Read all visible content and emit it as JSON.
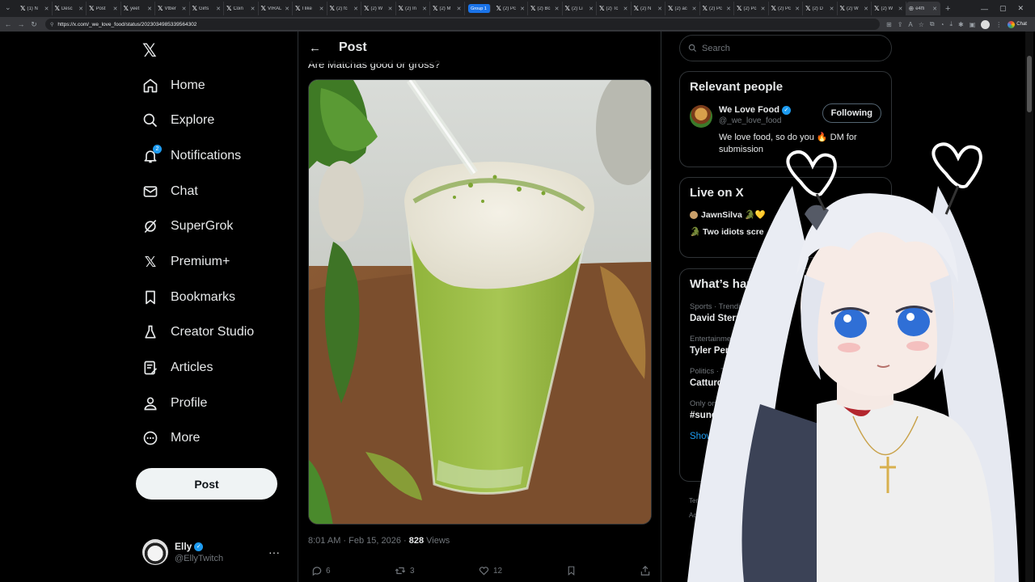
{
  "browser": {
    "tabs": [
      {
        "label": "(1) N"
      },
      {
        "label": "Desc"
      },
      {
        "label": "Post"
      },
      {
        "label": "yeet"
      },
      {
        "label": "Vtber"
      },
      {
        "label": "Girls"
      },
      {
        "label": "Coin"
      },
      {
        "label": "VIRAL"
      },
      {
        "label": "I like"
      },
      {
        "label": "(2) fc"
      },
      {
        "label": "(2) W"
      },
      {
        "label": "(2) In"
      },
      {
        "label": "(2) M"
      }
    ],
    "group_label": "Group 1",
    "tabs_after_group": [
      {
        "label": "(2) Pc"
      },
      {
        "label": "(2) Bc"
      },
      {
        "label": "(2) Li"
      },
      {
        "label": "(2) Tc"
      },
      {
        "label": "(2) N"
      },
      {
        "label": "(2) ac"
      },
      {
        "label": "(2) Pc"
      },
      {
        "label": "(2) Pc"
      },
      {
        "label": "(2) Pc"
      },
      {
        "label": "(2) D"
      },
      {
        "label": "(2) W"
      },
      {
        "label": "(2) W"
      }
    ],
    "last_tab": "e4ffi",
    "url": "https://x.com/_we_love_food/status/2023034985339564302",
    "chat_label": "Chat"
  },
  "nav": {
    "items": [
      {
        "label": "Home"
      },
      {
        "label": "Explore"
      },
      {
        "label": "Notifications",
        "badge": "2"
      },
      {
        "label": "Chat"
      },
      {
        "label": "SuperGrok"
      },
      {
        "label": "Premium+"
      },
      {
        "label": "Bookmarks"
      },
      {
        "label": "Creator Studio"
      },
      {
        "label": "Articles"
      },
      {
        "label": "Profile"
      },
      {
        "label": "More"
      }
    ],
    "post_button": "Post",
    "account": {
      "name": "Elly",
      "handle": "@EllyTwitch",
      "more": "···"
    }
  },
  "post": {
    "header_title": "Post",
    "text": "Are Matchas good or gross?",
    "time": "8:01 AM · Feb 15, 2026 · ",
    "views_count": "828",
    "views_label": " Views",
    "replies": "6",
    "reposts": "3",
    "likes": "12"
  },
  "sidebar": {
    "search_placeholder": "Search",
    "relevant_title": "Relevant people",
    "person": {
      "name": "We Love Food",
      "handle": "@_we_love_food",
      "bio": "We love food, so do you 🔥 DM for submission",
      "follow_label": "Following"
    },
    "live_title": "Live on X",
    "live_items": [
      {
        "text": "JawnSilva 🐊💛"
      },
      {
        "text": "🐊 Two idiots scre"
      }
    ],
    "happening_title": "What’s hap",
    "trends": [
      {
        "category": "Sports · Trending",
        "name": "David Stern"
      },
      {
        "category": "Entertainment · ",
        "name": "Tyler Perry"
      },
      {
        "category": "Politics · Tren",
        "name": "Catturd"
      },
      {
        "category": "Only on X",
        "name": "#sunda"
      }
    ],
    "show_more": "Show m",
    "footer": [
      "Terms",
      "Acce"
    ]
  }
}
